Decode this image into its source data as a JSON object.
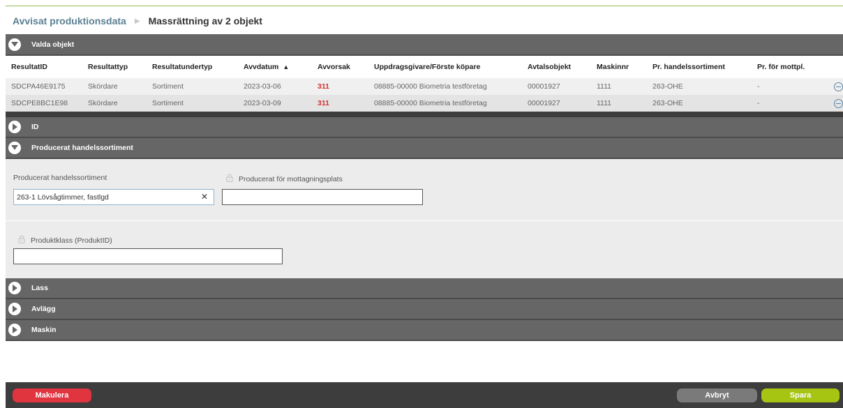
{
  "breadcrumb": {
    "parent": "Avvisat produktionsdata",
    "separator": "▶",
    "current": "Massrättning av 2 objekt"
  },
  "sections": {
    "valda_objekt": "Valda objekt",
    "id": "ID",
    "producerat": "Producerat handelssortiment",
    "lass": "Lass",
    "avlagg": "Avlägg",
    "maskin": "Maskin"
  },
  "table": {
    "columns": [
      "ResultatID",
      "Resultattyp",
      "Resultatundertyp",
      "Avvdatum",
      "Avvorsak",
      "Uppdragsgivare/Förste köpare",
      "Avtalsobjekt",
      "Maskinnr",
      "Pr. handelssortiment",
      "Pr. för mottpl."
    ],
    "sort_indicator": "▲",
    "rows": [
      [
        "SDCPA46E9175",
        "Skördare",
        "Sortiment",
        "2023-03-06",
        "311",
        "08885-00000 Biometria testföretag",
        "00001927",
        "1111",
        "263-OHE",
        "-"
      ],
      [
        "SDCPE8BC1E98",
        "Skördare",
        "Sortiment",
        "2023-03-09",
        "311",
        "08885-00000 Biometria testföretag",
        "00001927",
        "1111",
        "263-OHE",
        "-"
      ]
    ]
  },
  "form": {
    "handelssortiment_label": "Producerat handelssortiment",
    "handelssortiment_value": "263-1 Lövsågtimmer, fastlgd",
    "mottagningsplats_label": "Producerat för mottagningsplats",
    "mottagningsplats_value": "",
    "produktklass_label": "Produktklass (ProduktID)",
    "produktklass_value": "",
    "clear_symbol": "✕"
  },
  "footer": {
    "makulera": "Makulera",
    "avbryt": "Avbryt",
    "spara": "Spara"
  },
  "colors": {
    "header_bar": "#666666",
    "error_code": "#d0312d",
    "makulera": "#e0343f",
    "avbryt": "#7a7a7a",
    "spara": "#a6c512"
  },
  "icons": {
    "expanded": "chevron-down-circle-icon",
    "collapsed": "chevron-right-circle-icon",
    "remove": "minus-circle-icon",
    "lock": "lock-icon"
  }
}
